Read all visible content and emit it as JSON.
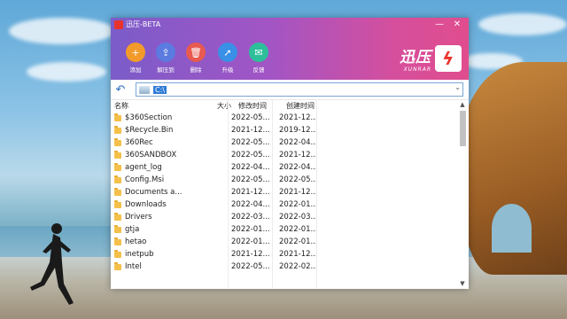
{
  "window": {
    "title": "迅压-BETA",
    "minimize": "—",
    "close": "✕"
  },
  "toolbar": [
    {
      "label": "添加",
      "icon": "add-icon",
      "color": "#f29b2a",
      "glyph": "+"
    },
    {
      "label": "解压到",
      "icon": "extract-icon",
      "color": "#5b7be0",
      "glyph": "⇪"
    },
    {
      "label": "删除",
      "icon": "trash-icon",
      "color": "#e85a4f",
      "glyph": "🗑"
    },
    {
      "label": "升级",
      "icon": "rocket-icon",
      "color": "#3a8fe6",
      "glyph": "➚"
    },
    {
      "label": "反馈",
      "icon": "feedback-icon",
      "color": "#2cbf9a",
      "glyph": "✉"
    }
  ],
  "brand": {
    "cn": "迅压",
    "en": "XUNRAR"
  },
  "address": {
    "path": "C:\\"
  },
  "columns": {
    "name": "名称",
    "size": "大小",
    "modified": "修改时间",
    "created": "创建时间"
  },
  "files": [
    {
      "name": "$360Section",
      "modified": "2022-05...",
      "created": "2021-12..."
    },
    {
      "name": "$Recycle.Bin",
      "modified": "2021-12...",
      "created": "2019-12..."
    },
    {
      "name": "360Rec",
      "modified": "2022-05...",
      "created": "2022-04..."
    },
    {
      "name": "360SANDBOX",
      "modified": "2022-05...",
      "created": "2021-12..."
    },
    {
      "name": "agent_log",
      "modified": "2022-04...",
      "created": "2022-04..."
    },
    {
      "name": "Config.Msi",
      "modified": "2022-05...",
      "created": "2022-05..."
    },
    {
      "name": "Documents a...",
      "modified": "2021-12...",
      "created": "2021-12..."
    },
    {
      "name": "Downloads",
      "modified": "2022-04...",
      "created": "2022-01..."
    },
    {
      "name": "Drivers",
      "modified": "2022-03...",
      "created": "2022-03..."
    },
    {
      "name": "gtja",
      "modified": "2022-01...",
      "created": "2022-01..."
    },
    {
      "name": "hetao",
      "modified": "2022-01...",
      "created": "2022-01..."
    },
    {
      "name": "inetpub",
      "modified": "2021-12...",
      "created": "2021-12..."
    },
    {
      "name": "Intel",
      "modified": "2022-05...",
      "created": "2022-02..."
    }
  ]
}
